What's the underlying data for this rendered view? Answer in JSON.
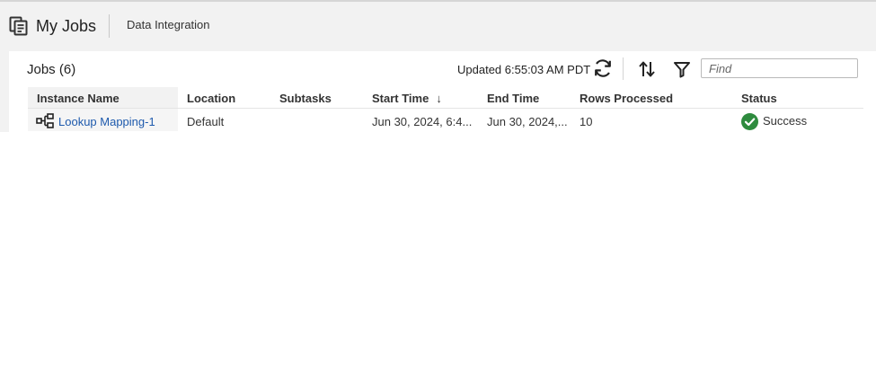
{
  "header": {
    "title": "My Jobs",
    "subtitle": "Data Integration"
  },
  "toolbar": {
    "jobs_title": "Jobs (6)",
    "updated": "Updated 6:55:03 AM PDT",
    "find_placeholder": "Find"
  },
  "table": {
    "columns": {
      "instance_name": "Instance Name",
      "location": "Location",
      "subtasks": "Subtasks",
      "start_time": "Start Time",
      "end_time": "End Time",
      "rows_processed": "Rows Processed",
      "status": "Status"
    },
    "sort_indicator": "↓",
    "rows": [
      {
        "instance_name": "Lookup Mapping-1",
        "location": "Default",
        "subtasks": "",
        "start_time": "Jun 30, 2024, 6:4...",
        "end_time": "Jun 30, 2024,...",
        "rows_processed": "10",
        "status": "Success"
      }
    ]
  },
  "colors": {
    "link": "#1e5aad",
    "success": "#2e8b3e",
    "header_bg": "#f2f2f2"
  },
  "icons": {
    "header": "my-jobs-icon",
    "refresh": "refresh-icon",
    "sort": "sort-icon",
    "filter": "filter-icon",
    "mapping": "mapping-icon",
    "status": "success-check-icon"
  }
}
